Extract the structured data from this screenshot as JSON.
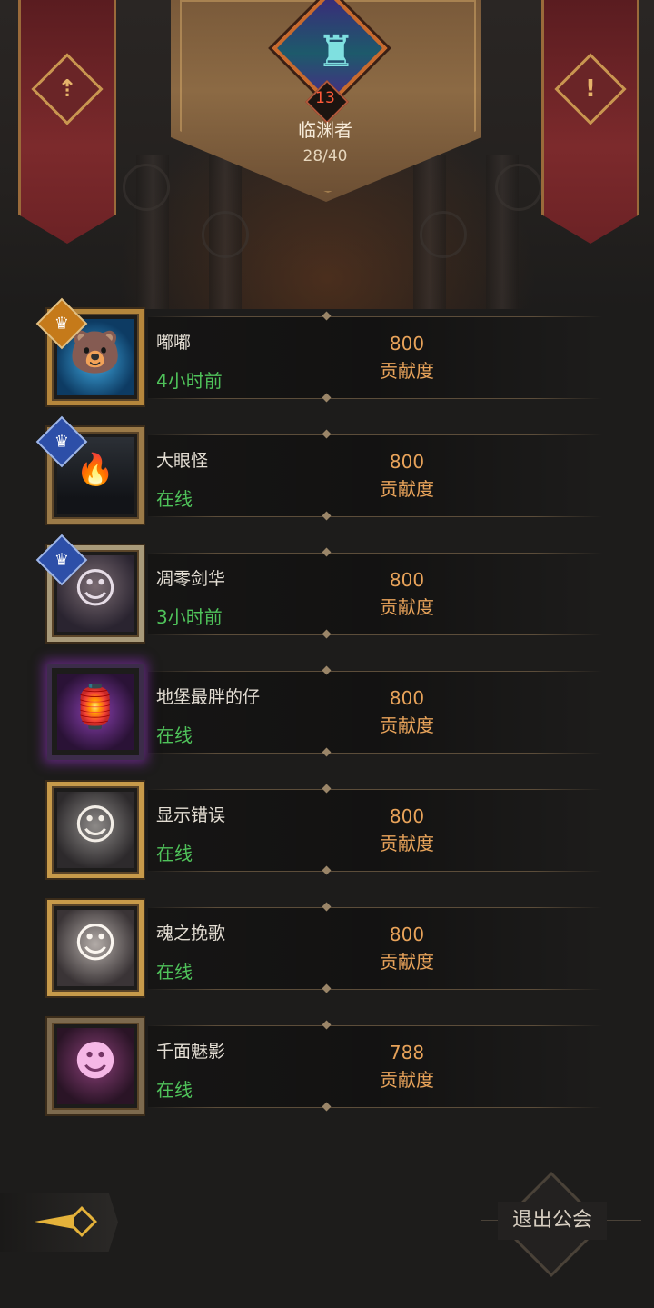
{
  "guild": {
    "level": "13",
    "name": "临渊者",
    "member_count": "28/40"
  },
  "members": [
    {
      "name": "嘟嘟",
      "status": "4小时前",
      "score": "800",
      "score_unit": "贡献度",
      "rank": "gold-crown",
      "avatar": "blue-bear"
    },
    {
      "name": "大眼怪",
      "status": "在线",
      "score": "800",
      "score_unit": "贡献度",
      "rank": "silver-crown",
      "avatar": "torch-corridor"
    },
    {
      "name": "凋零剑华",
      "status": "3小时前",
      "score": "800",
      "score_unit": "贡献度",
      "rank": "silver-crown",
      "avatar": "silver-haired-warrior"
    },
    {
      "name": "地堡最胖的仔",
      "status": "在线",
      "score": "800",
      "score_unit": "贡献度",
      "rank": "",
      "avatar": "purple-lantern"
    },
    {
      "name": "显示错误",
      "status": "在线",
      "score": "800",
      "score_unit": "贡献度",
      "rank": "",
      "avatar": "crowned-maiden"
    },
    {
      "name": "魂之挽歌",
      "status": "在线",
      "score": "800",
      "score_unit": "贡献度",
      "rank": "",
      "avatar": "white-haired-woman"
    },
    {
      "name": "千面魅影",
      "status": "在线",
      "score": "788",
      "score_unit": "贡献度",
      "rank": "",
      "avatar": "masked-phantom"
    }
  ],
  "footer": {
    "exit_label": "退出公会"
  },
  "colors": {
    "status_online": "#4fc25a",
    "score": "#e8a35a",
    "level_number": "#ff5a3a",
    "banner_red": "#7c2a2c",
    "frame_gold": "#9b7a48"
  },
  "icons": {
    "left_banner": "guild-emblem-icon",
    "right_banner": "guild-info-icon",
    "back": "back-arrow-icon"
  }
}
